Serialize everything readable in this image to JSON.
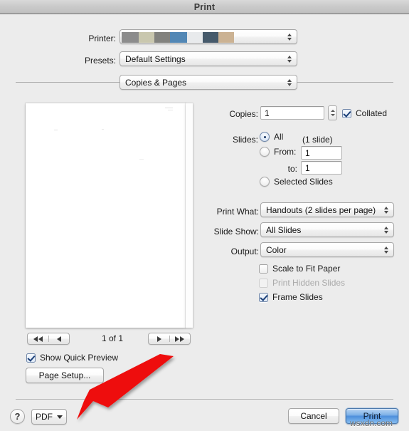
{
  "window": {
    "title": "Print"
  },
  "printer_row": {
    "label": "Printer:",
    "value": "",
    "redaction_colors": [
      "#8c8c8c",
      "#c9c7ae",
      "#82827e",
      "#5287b5",
      "#e8eaec",
      "#465a6b",
      "#cbb293"
    ]
  },
  "presets_row": {
    "label": "Presets:",
    "value": "Default Settings"
  },
  "pane_popup": {
    "value": "Copies & Pages"
  },
  "copies": {
    "label": "Copies:",
    "value": "1",
    "collated_label": "Collated",
    "collated_checked": true
  },
  "slides": {
    "label": "Slides:",
    "all_label": "All",
    "all_selected": true,
    "slide_count_note": "(1 slide)",
    "from_label": "From:",
    "from_value": "1",
    "to_label": "to:",
    "to_value": "1",
    "selected_slides_label": "Selected Slides"
  },
  "print_what": {
    "label": "Print What:",
    "value": "Handouts (2 slides per page)"
  },
  "slide_show": {
    "label": "Slide Show:",
    "value": "All Slides"
  },
  "output": {
    "label": "Output:",
    "value": "Color"
  },
  "options": [
    {
      "label": "Scale to Fit Paper",
      "checked": false,
      "disabled": false
    },
    {
      "label": "Print Hidden Slides",
      "checked": false,
      "disabled": true
    },
    {
      "label": "Frame Slides",
      "checked": true,
      "disabled": false
    }
  ],
  "preview": {
    "page_indicator": "1 of 1",
    "first_icon": "rewind-double-arrow-icon",
    "prev_icon": "previous-arrow-icon",
    "next_icon": "next-arrow-icon",
    "last_icon": "forward-double-arrow-icon",
    "show_quick_preview_label": "Show Quick Preview",
    "show_quick_preview_checked": true,
    "page_setup_label": "Page Setup..."
  },
  "footer": {
    "help_label": "?",
    "pdf_label": "PDF",
    "cancel_label": "Cancel",
    "print_label": "Print"
  },
  "annotation": {
    "arrow_color": "#ee1111",
    "watermark": "wsxdn.com"
  }
}
